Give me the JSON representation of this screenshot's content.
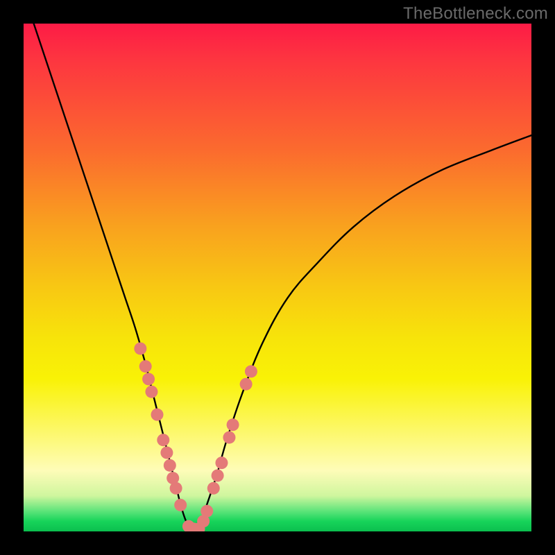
{
  "watermark": "TheBottleneck.com",
  "chart_data": {
    "type": "line",
    "title": "",
    "xlabel": "",
    "ylabel": "",
    "xlim": [
      0,
      100
    ],
    "ylim": [
      0,
      100
    ],
    "series": [
      {
        "name": "bottleneck-curve",
        "x": [
          2,
          6,
          10,
          14,
          18,
          20,
          22,
          24,
          25.5,
          27,
          28.5,
          30,
          31,
          32,
          33,
          34,
          35,
          36,
          38,
          40,
          43,
          47,
          52,
          58,
          65,
          73,
          82,
          92,
          100
        ],
        "y": [
          100,
          88,
          76,
          64,
          52,
          46,
          40,
          33,
          27,
          21,
          15,
          9,
          5,
          2,
          0.5,
          0.5,
          2,
          5,
          11,
          18,
          27,
          37,
          46,
          53,
          60,
          66,
          71,
          75,
          78
        ]
      }
    ],
    "markers": {
      "name": "highlighted-points",
      "color": "#e47a78",
      "points": [
        {
          "x": 23.0,
          "y": 36.0
        },
        {
          "x": 24.0,
          "y": 32.5
        },
        {
          "x": 24.6,
          "y": 30.0
        },
        {
          "x": 25.2,
          "y": 27.5
        },
        {
          "x": 26.3,
          "y": 23.0
        },
        {
          "x": 27.5,
          "y": 18.0
        },
        {
          "x": 28.2,
          "y": 15.5
        },
        {
          "x": 28.8,
          "y": 13.0
        },
        {
          "x": 29.4,
          "y": 10.5
        },
        {
          "x": 30.0,
          "y": 8.5
        },
        {
          "x": 30.9,
          "y": 5.2
        },
        {
          "x": 32.5,
          "y": 1.0
        },
        {
          "x": 33.5,
          "y": 0.5
        },
        {
          "x": 34.5,
          "y": 0.5
        },
        {
          "x": 35.4,
          "y": 2.0
        },
        {
          "x": 36.1,
          "y": 4.0
        },
        {
          "x": 37.4,
          "y": 8.5
        },
        {
          "x": 38.2,
          "y": 11.0
        },
        {
          "x": 39.0,
          "y": 13.5
        },
        {
          "x": 40.5,
          "y": 18.5
        },
        {
          "x": 41.2,
          "y": 21.0
        },
        {
          "x": 43.8,
          "y": 29.0
        },
        {
          "x": 44.8,
          "y": 31.5
        }
      ]
    },
    "background_gradient": {
      "top": "#fd1b46",
      "upper_mid": "#f9a21e",
      "mid": "#f8e009",
      "lower_mid": "#fefcb8",
      "bottom": "#0bbf4e"
    }
  }
}
